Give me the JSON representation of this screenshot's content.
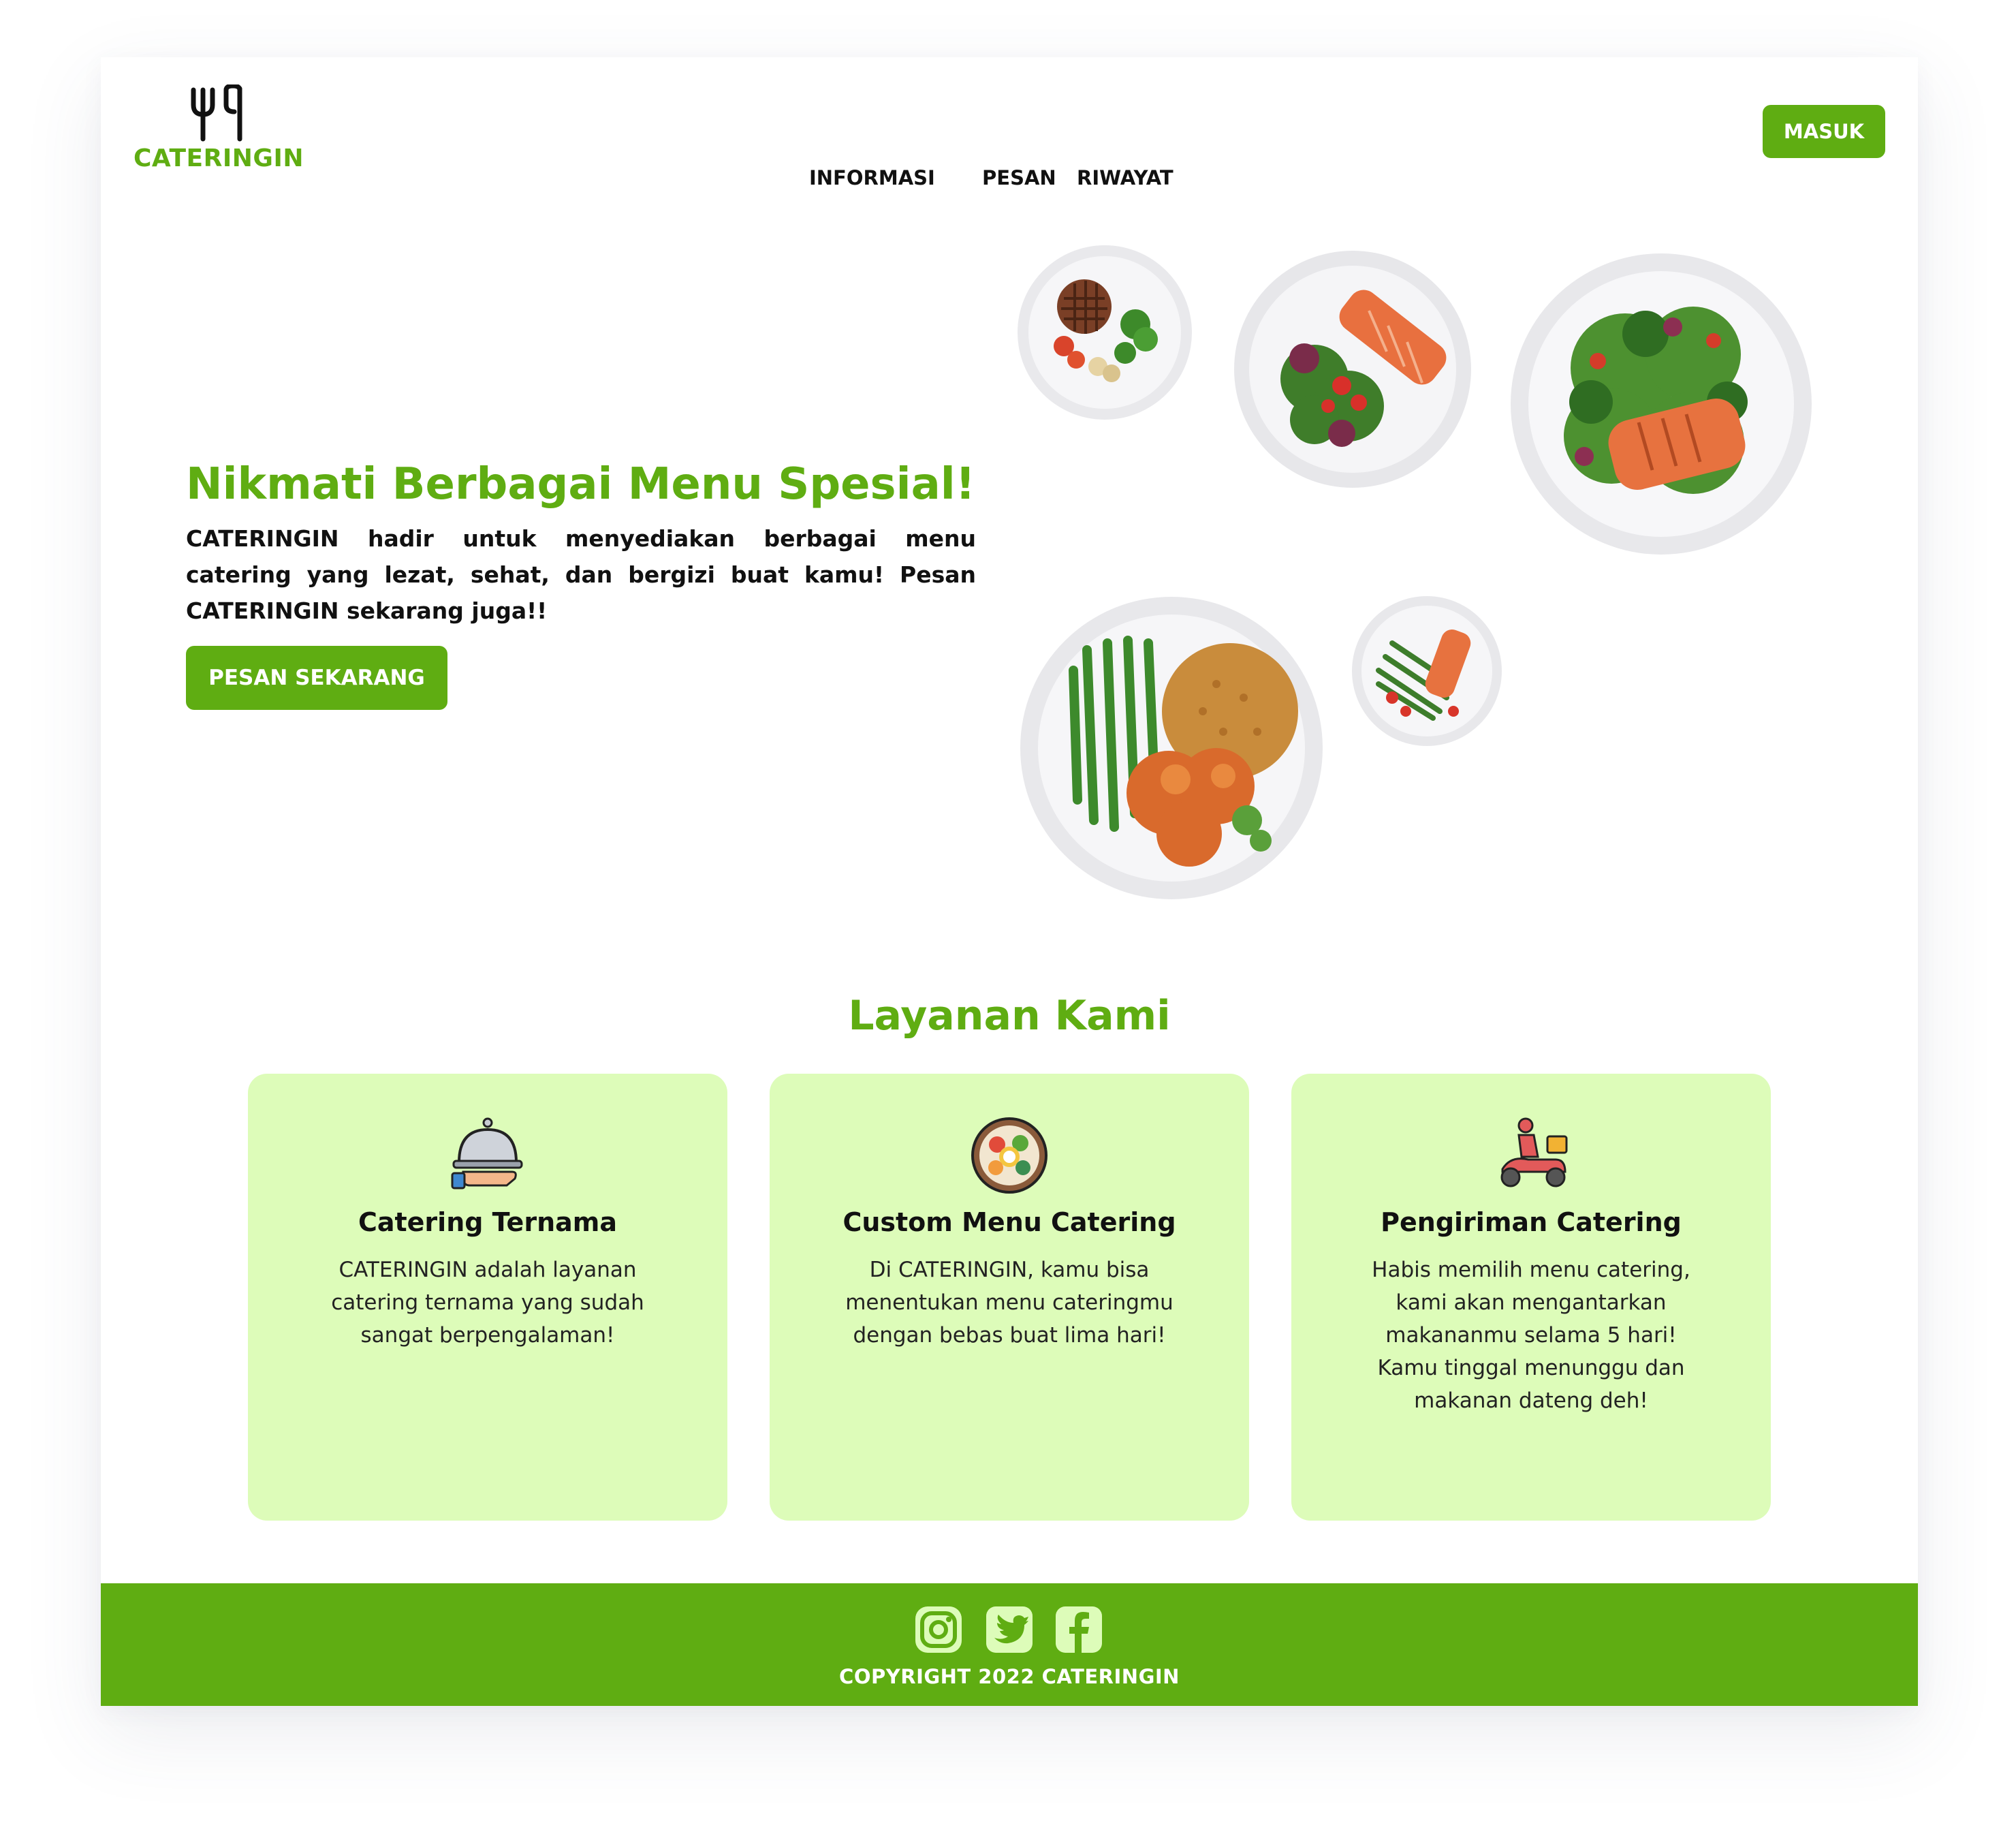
{
  "colors": {
    "brand_green": "#5fad12",
    "card_bg": "#ddfcb9",
    "text": "#111111"
  },
  "header": {
    "brand": "CATERINGIN",
    "logo_icon": "fork-and-spoon-icon",
    "nav": [
      "INFORMASI",
      "PESAN",
      "RIWAYAT"
    ],
    "login_label": "MASUK"
  },
  "hero": {
    "title": "Nikmati Berbagai Menu Spesial!",
    "description": "CATERINGIN hadir untuk menyediakan berbagai menu catering yang lezat, sehat, dan bergizi buat kamu! Pesan CATERINGIN sekarang juga!!",
    "cta_label": "PESAN SEKARANG",
    "plates": [
      "steak-plate",
      "salmon-salad-plate",
      "salmon-greens-plate",
      "chicken-rice-beans-plate",
      "salmon-asparagus-plate"
    ]
  },
  "services": {
    "title": "Layanan Kami",
    "cards": [
      {
        "icon": "serving-cloche-icon",
        "title": "Catering Ternama",
        "text": "CATERINGIN adalah layanan catering ternama yang sudah sangat berpengalaman!"
      },
      {
        "icon": "food-bowl-icon",
        "title": "Custom Menu Catering",
        "text": "Di CATERINGIN, kamu bisa menentukan menu cateringmu dengan bebas buat lima hari!"
      },
      {
        "icon": "delivery-scooter-icon",
        "title": "Pengiriman Catering",
        "text": "Habis memilih menu catering, kami akan mengantarkan makananmu selama 5 hari! Kamu tinggal menunggu dan makanan dateng deh!"
      }
    ]
  },
  "footer": {
    "social": [
      "instagram-icon",
      "twitter-icon",
      "facebook-icon"
    ],
    "copyright": "COPYRIGHT 2022 CATERINGIN"
  }
}
